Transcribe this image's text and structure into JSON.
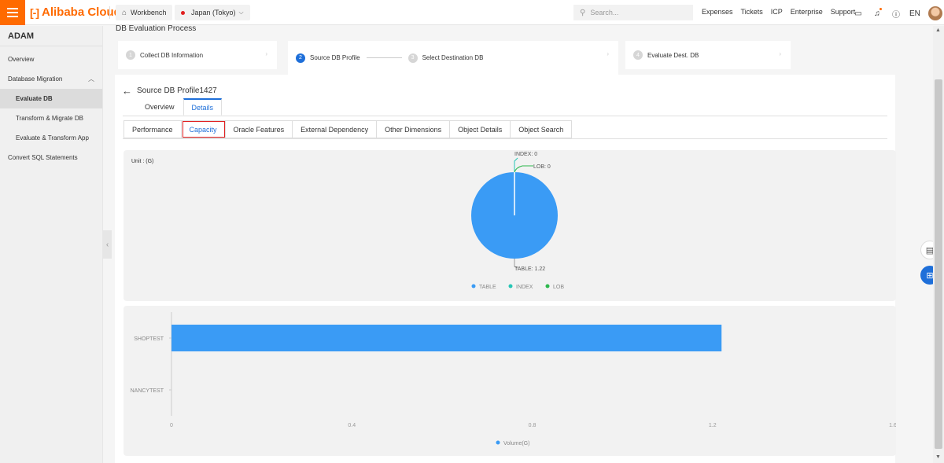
{
  "topbar": {
    "logo": "Alibaba Cloud",
    "workbench": "Workbench",
    "region": "Japan (Tokyo)",
    "search_placeholder": "Search...",
    "links": [
      "Expenses",
      "Tickets",
      "ICP",
      "Enterprise",
      "Support"
    ],
    "lang": "EN"
  },
  "sidebar": {
    "title": "ADAM",
    "items": [
      {
        "label": "Overview"
      },
      {
        "label": "Database Migration"
      },
      {
        "label": "Evaluate DB"
      },
      {
        "label": "Transform & Migrate DB"
      },
      {
        "label": "Evaluate & Transform App"
      },
      {
        "label": "Convert SQL Statements"
      }
    ]
  },
  "process": {
    "title": "DB Evaluation Process",
    "steps": [
      {
        "num": "1",
        "label": "Collect DB Information"
      },
      {
        "num": "2",
        "label": "Source DB Profile"
      },
      {
        "num": "3",
        "label": "Select Destination DB"
      },
      {
        "num": "4",
        "label": "Evaluate Dest. DB"
      }
    ]
  },
  "profile": {
    "title": "Source DB Profile1427",
    "subtabs": [
      "Overview",
      "Details"
    ],
    "tabs": [
      "Performance",
      "Capacity",
      "Oracle Features",
      "External Dependency",
      "Other Dimensions",
      "Object Details",
      "Object Search"
    ]
  },
  "chart_data": [
    {
      "type": "pie",
      "unit_label": "Unit : (G)",
      "categories": [
        "TABLE",
        "INDEX",
        "LOB"
      ],
      "values": [
        1.22,
        0,
        0
      ],
      "slice_labels": [
        "TABLE: 1.22",
        "INDEX: 0",
        "LOB: 0"
      ],
      "colors": [
        "#3a9bf5",
        "#26c6b5",
        "#2db84d"
      ],
      "legend": "bottom-center"
    },
    {
      "type": "bar",
      "orientation": "horizontal",
      "categories": [
        "SHOPTEST",
        "NANCYTEST"
      ],
      "series": [
        {
          "name": "Volume(G)",
          "values": [
            1.22,
            0
          ]
        }
      ],
      "xlim": [
        0,
        1.6
      ],
      "xticks": [
        "0",
        "0.4",
        "0.8",
        "1.2",
        "1.6"
      ],
      "color": "#3a9bf5",
      "legend": "bottom-center"
    }
  ]
}
